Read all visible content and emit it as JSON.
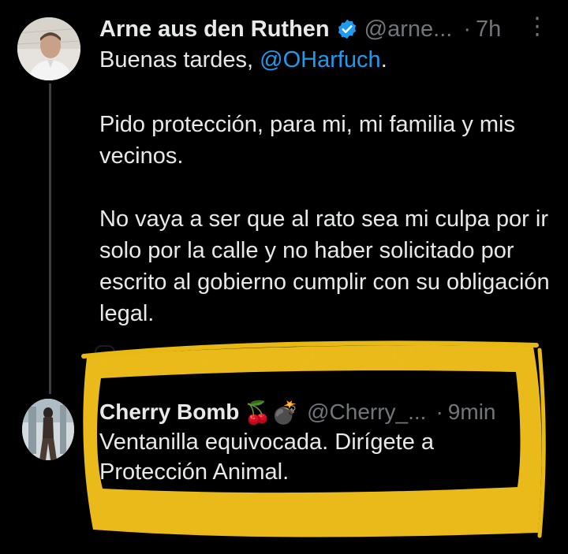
{
  "tweet": {
    "author_name": "Arne aus den Ruthen",
    "author_handle": "@arne...",
    "separator": "·",
    "time": "7h",
    "more_label": "⋮",
    "paragraph1_prefix": "Buenas tardes, ",
    "mention": "@OHarfuch",
    "paragraph1_suffix": ".",
    "paragraph2": "Pido protección, para mi, mi familia y mis vecinos.",
    "paragraph3": "No vaya a ser que al rato sea mi culpa por ir solo por la calle y no haber solicitado por escrito al gobierno cumplir con su obligación legal."
  },
  "reply": {
    "author_name": "Cherry Bomb",
    "emoji": "🍒💣",
    "author_handle": "@Cherry_...",
    "separator": "·",
    "time": "9min",
    "text": "Ventanilla equivocada. Dirígete a Protección Animal."
  },
  "colors": {
    "background": "#000000",
    "text": "#e7e9ea",
    "secondary": "#71767b",
    "link": "#1d9bf0",
    "verified": "#1d9bf0",
    "highlight_marker": "#f2c21b"
  },
  "icons": {
    "verified": "verified-badge-icon",
    "more": "more-vertical-icon"
  }
}
